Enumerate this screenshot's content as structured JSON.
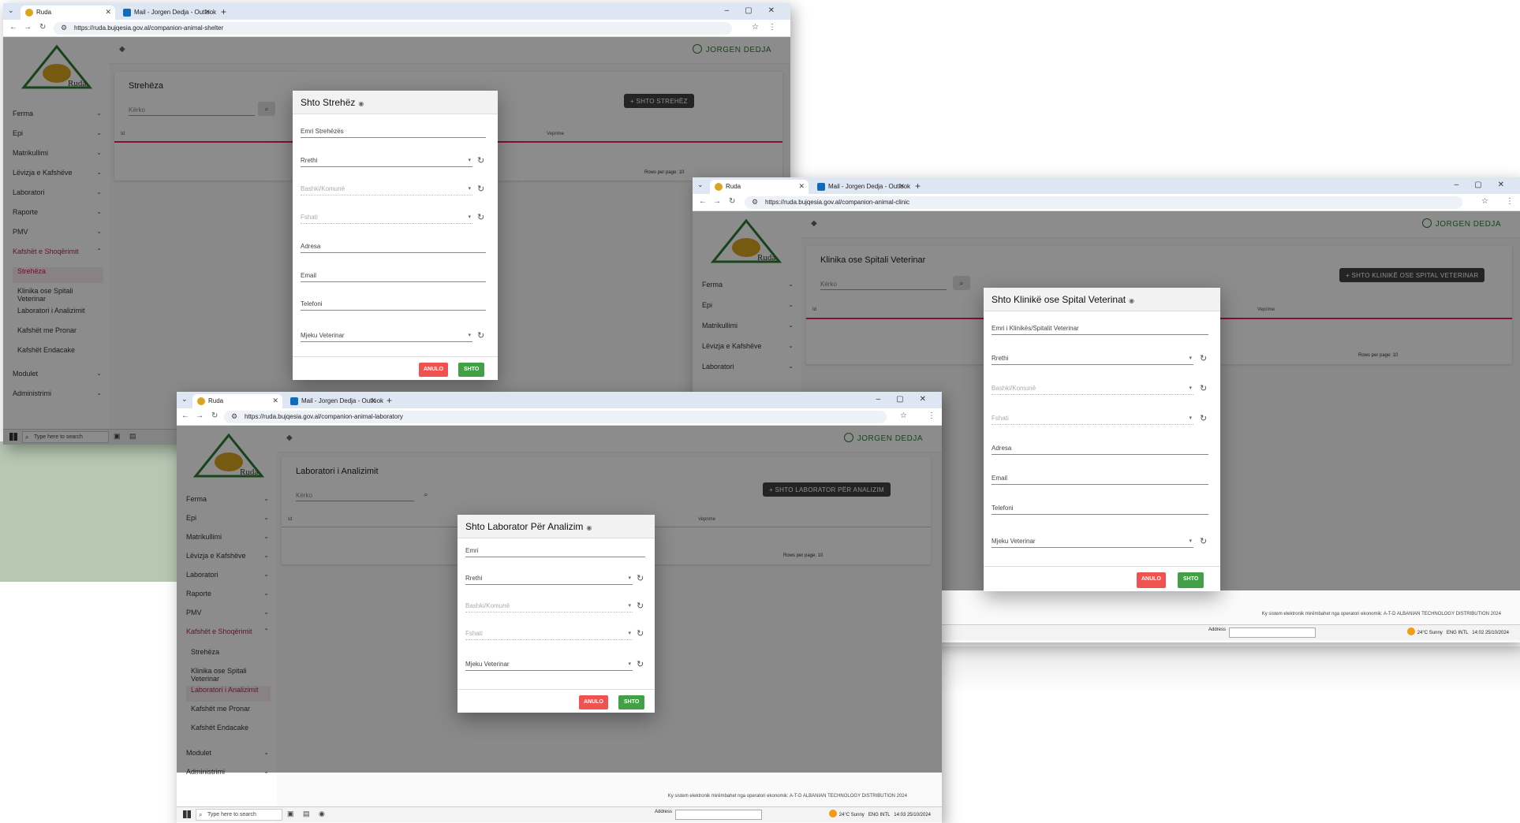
{
  "windows": {
    "shelter": {
      "tabs": [
        {
          "label": "Ruda"
        },
        {
          "label": "Mail - Jorgen Dedja - Outlook"
        }
      ],
      "url": "https://ruda.bujqesia.gov.al/companion-animal-shelter",
      "user": "JORGEN DEDJA",
      "sidebar": [
        "Ferma",
        "Epi",
        "Matrikullimi",
        "Lëvizja e Kafshëve",
        "Laboratori",
        "Raporte",
        "PMV",
        "Kafshët e Shoqërimit"
      ],
      "sub_items": [
        "Strehëza",
        "Klinika ose Spitali Veterinar",
        "Laboratori i Analizimit",
        "Kafshët me Pronar",
        "Kafshët Endacake"
      ],
      "sidebar_bottom": [
        "Modulet",
        "Administrimi"
      ],
      "page_title": "Strehëza",
      "search_placeholder": "Kërko",
      "add_button": "+ SHTO STREHËZ",
      "columns": [
        "Id",
        "Veprime"
      ],
      "rows_per_page_label": "Rows per page:",
      "rows_per_page": "10",
      "dialog": {
        "title": "Shto Strehëz",
        "fields": [
          "Emri Strehëzës",
          "Rrethi",
          "Bashki/Komunë",
          "Fshati",
          "Adresa",
          "Email",
          "Telefoni",
          "Mjeku Veterinar"
        ],
        "cancel": "ANULO",
        "ok": "SHTO"
      },
      "taskbar_search": "Type here to search"
    },
    "clinic": {
      "tabs": [
        {
          "label": "Ruda"
        },
        {
          "label": "Mail - Jorgen Dedja - Outlook"
        }
      ],
      "url": "https://ruda.bujqesia.gov.al/companion-animal-clinic",
      "user": "JORGEN DEDJA",
      "sidebar": [
        "Ferma",
        "Epi",
        "Matrikullimi",
        "Lëvizja e Kafshëve",
        "Laboratori"
      ],
      "page_title": "Klinika ose Spitali Veterinar",
      "search_placeholder": "Kërko",
      "add_button": "+ SHTO KLINIKË OSE SPITAL VETERINAR",
      "columns": [
        "Id",
        "Veprime"
      ],
      "rows_per_page_label": "Rows per page:",
      "rows_per_page": "10",
      "dialog": {
        "title": "Shto Klinikë ose Spital Veterinat",
        "fields": [
          "Emri i Klinikës/Spitalit Veterinar",
          "Rrethi",
          "Bashki/Komunë",
          "Fshati",
          "Adresa",
          "Email",
          "Telefoni",
          "Mjeku Veterinar"
        ],
        "cancel": "ANULO",
        "ok": "SHTO"
      },
      "footer": "Ky sistem elektronik mirëmbahet nga operatori ekonomik: A-T-D ALBANIAN TECHNOLOGY DISTRIBUTION 2024",
      "taskbar": {
        "address_label": "Address",
        "weather": "24°C  Sunny",
        "lang": "ENG INTL",
        "time": "14:02",
        "date": "25/10/2024"
      }
    },
    "laboratory": {
      "tabs": [
        {
          "label": "Ruda"
        },
        {
          "label": "Mail - Jorgen Dedja - Outlook"
        }
      ],
      "url": "https://ruda.bujqesia.gov.al/companion-animal-laboratory",
      "user": "JORGEN DEDJA",
      "sidebar": [
        "Ferma",
        "Epi",
        "Matrikullimi",
        "Lëvizja e Kafshëve",
        "Laboratori",
        "Raporte",
        "PMV",
        "Kafshët e Shoqërimit"
      ],
      "sub_items": [
        "Strehëza",
        "Klinika ose Spitali Veterinar",
        "Laboratori i Analizimit",
        "Kafshët me Pronar",
        "Kafshët Endacake"
      ],
      "sidebar_bottom": [
        "Modulet",
        "Administrimi"
      ],
      "page_title": "Laboratori i Analizimit",
      "search_placeholder": "Kërko",
      "add_button": "+ SHTO LABORATOR PËR ANALIZIM",
      "columns": [
        "Id",
        "Veprime"
      ],
      "rows_per_page_label": "Rows per page:",
      "rows_per_page": "10",
      "dialog": {
        "title": "Shto Laborator Për Analizim",
        "fields": [
          "Emri",
          "Rrethi",
          "Bashki/Komunë",
          "Fshati",
          "Mjeku Veterinar"
        ],
        "cancel": "ANULO",
        "ok": "SHTO"
      },
      "footer": "Ky sistem elektronik mirëmbahet nga operatori ekonomik: A-T-D ALBANIAN TECHNOLOGY DISTRIBUTION 2024",
      "taskbar": {
        "search": "Type here to search",
        "address_label": "Address",
        "weather": "24°C  Sunny",
        "lang": "ENG INTL",
        "time": "14:03",
        "date": "25/10/2024"
      }
    }
  }
}
